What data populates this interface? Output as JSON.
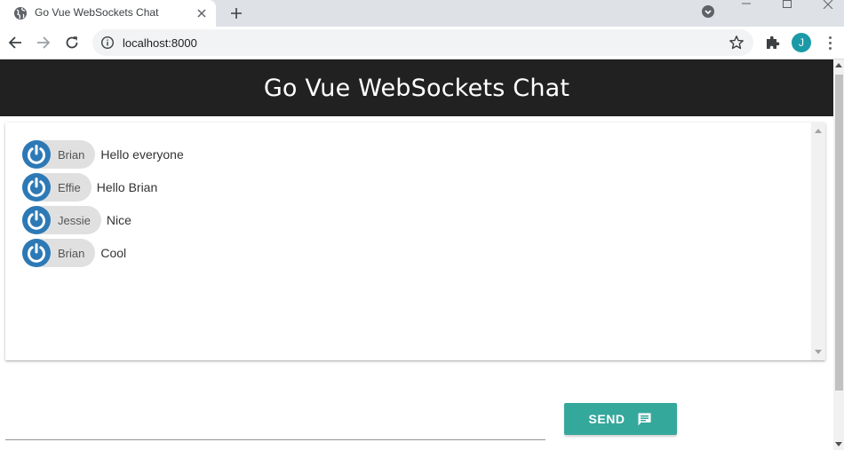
{
  "browser": {
    "tab_title": "Go Vue WebSockets Chat",
    "url": "localhost:8000",
    "profile_initial": "J",
    "favicon": "globe-icon"
  },
  "app": {
    "title": "Go Vue WebSockets Chat"
  },
  "messages": [
    {
      "user": "Brian",
      "text": "Hello everyone"
    },
    {
      "user": "Effie",
      "text": "Hello Brian"
    },
    {
      "user": "Jessie",
      "text": "Nice"
    },
    {
      "user": "Brian",
      "text": "Cool"
    }
  ],
  "composer": {
    "input_value": "",
    "send_label": "SEND"
  },
  "colors": {
    "header_bg": "#212121",
    "chip_bg": "#e0e0e0",
    "avatar": "#2d79b6",
    "send_button": "#35a89c"
  }
}
